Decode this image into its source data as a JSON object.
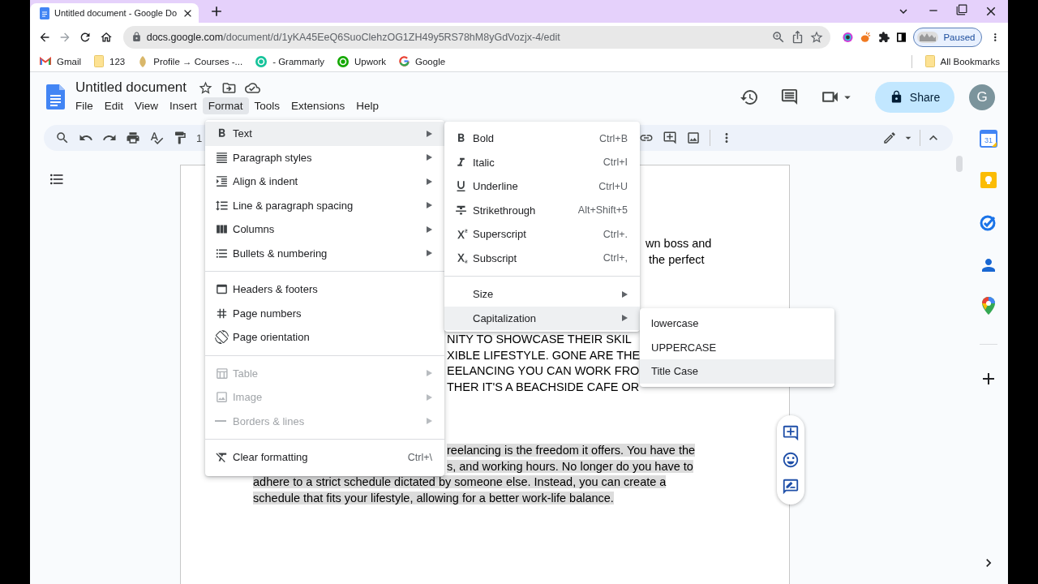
{
  "browser": {
    "tab_title": "Untitled document - Google Do",
    "address_domain": "docs.google.com",
    "address_path": "/document/d/1yKA45EeQ6SuoClehzOG1ZH49y5RS78hM8yGdVozjx-4/edit",
    "profile": "Paused",
    "bookmarks": [
      {
        "label": "Gmail"
      },
      {
        "label": "123"
      },
      {
        "label": "Profile → Courses -..."
      },
      {
        "label": "- Grammarly"
      },
      {
        "label": "Upwork"
      },
      {
        "label": "Google"
      }
    ],
    "all_bookmarks": "All Bookmarks"
  },
  "document": {
    "title": "Untitled document",
    "menu": [
      {
        "label": "File",
        "selected": false
      },
      {
        "label": "Edit",
        "selected": false
      },
      {
        "label": "View",
        "selected": false
      },
      {
        "label": "Insert",
        "selected": false
      },
      {
        "label": "Format",
        "selected": true
      },
      {
        "label": "Tools",
        "selected": false
      },
      {
        "label": "Extensions",
        "selected": false
      },
      {
        "label": "Help",
        "selected": false
      }
    ],
    "share": "Share",
    "avatar": "G",
    "zoom": "1"
  },
  "format_menu": {
    "groups": [
      [
        {
          "label": "Text",
          "submenu": true,
          "selected": true,
          "disabled": false
        },
        {
          "label": "Paragraph styles",
          "submenu": true,
          "selected": false,
          "disabled": false
        },
        {
          "label": "Align & indent",
          "submenu": true,
          "selected": false,
          "disabled": false
        },
        {
          "label": "Line & paragraph spacing",
          "submenu": true,
          "selected": false,
          "disabled": false
        },
        {
          "label": "Columns",
          "submenu": true,
          "selected": false,
          "disabled": false
        },
        {
          "label": "Bullets & numbering",
          "submenu": true,
          "selected": false,
          "disabled": false
        }
      ],
      [
        {
          "label": "Headers & footers",
          "submenu": false,
          "selected": false,
          "disabled": false
        },
        {
          "label": "Page numbers",
          "submenu": false,
          "selected": false,
          "disabled": false
        },
        {
          "label": "Page orientation",
          "submenu": false,
          "selected": false,
          "disabled": false
        }
      ],
      [
        {
          "label": "Table",
          "submenu": true,
          "selected": false,
          "disabled": true
        },
        {
          "label": "Image",
          "submenu": true,
          "selected": false,
          "disabled": true
        },
        {
          "label": "Borders & lines",
          "submenu": true,
          "selected": false,
          "disabled": true
        }
      ],
      [
        {
          "label": "Clear formatting",
          "shortcut": "Ctrl+\\",
          "submenu": false,
          "selected": false,
          "disabled": false
        }
      ]
    ]
  },
  "text_menu": {
    "groups": [
      [
        {
          "label": "Bold",
          "shortcut": "Ctrl+B",
          "submenu": false,
          "selected": false
        },
        {
          "label": "Italic",
          "shortcut": "Ctrl+I",
          "submenu": false,
          "selected": false
        },
        {
          "label": "Underline",
          "shortcut": "Ctrl+U",
          "submenu": false,
          "selected": false
        },
        {
          "label": "Strikethrough",
          "shortcut": "Alt+Shift+5",
          "submenu": false,
          "selected": false
        },
        {
          "label": "Superscript",
          "shortcut": "Ctrl+.",
          "submenu": false,
          "selected": false
        },
        {
          "label": "Subscript",
          "shortcut": "Ctrl+,",
          "submenu": false,
          "selected": false
        }
      ],
      [
        {
          "label": "Size",
          "submenu": true,
          "selected": false
        },
        {
          "label": "Capitalization",
          "submenu": true,
          "selected": true
        }
      ]
    ]
  },
  "capitalization_menu": {
    "items": [
      {
        "label": "lowercase",
        "selected": false
      },
      {
        "label": "UPPERCASE",
        "selected": false
      },
      {
        "label": "Title Case",
        "selected": true
      }
    ]
  },
  "page": {
    "lines": [
      {
        "text": "wn boss and",
        "highlighted": false
      },
      {
        "text": "the perfect",
        "highlighted": false
      },
      {
        "text": "NITY TO SHOWCASE THEIR SKIL",
        "highlighted": false
      },
      {
        "text": "XIBLE LIFESTYLE. GONE ARE THE",
        "highlighted": false
      },
      {
        "text": "EELANCING YOU CAN WORK FRO",
        "highlighted": false
      },
      {
        "text": "THER IT'S A BEACHSIDE CAFE OR",
        "highlighted": false
      },
      {
        "text": "reelancing is the freedom it offers. You have the",
        "highlighted": true
      },
      {
        "text": "s, and working hours. No longer do you have to",
        "highlighted": true
      },
      {
        "text": "adhere to a strict schedule dictated by someone else. Instead, you can create a",
        "highlighted": true
      },
      {
        "text": "schedule that fits your lifestyle, allowing for a better work-life balance. ",
        "highlighted": true
      }
    ]
  },
  "side_panel": {
    "calendar_date": "31"
  }
}
